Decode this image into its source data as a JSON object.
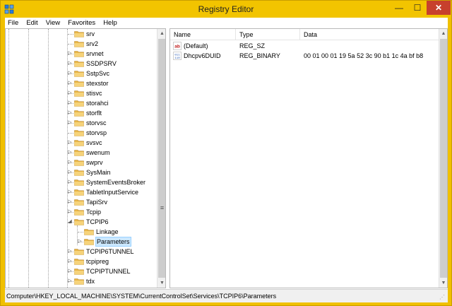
{
  "window": {
    "title": "Registry Editor",
    "minimize_glyph": "—",
    "maximize_glyph": "☐",
    "close_glyph": "✕",
    "accent": "#f2c400",
    "close_color": "#c7402d"
  },
  "menu": {
    "items": [
      "File",
      "Edit",
      "View",
      "Favorites",
      "Help"
    ]
  },
  "tree": {
    "expand_glyph": "▷",
    "collapse_glyph": "◢",
    "items": [
      {
        "label": "srv",
        "expander": "none",
        "indent": 0
      },
      {
        "label": "srv2",
        "expander": "none",
        "indent": 0
      },
      {
        "label": "srvnet",
        "expander": "collapsed",
        "indent": 0
      },
      {
        "label": "SSDPSRV",
        "expander": "collapsed",
        "indent": 0
      },
      {
        "label": "SstpSvc",
        "expander": "collapsed",
        "indent": 0
      },
      {
        "label": "stexstor",
        "expander": "collapsed",
        "indent": 0
      },
      {
        "label": "stisvc",
        "expander": "collapsed",
        "indent": 0
      },
      {
        "label": "storahci",
        "expander": "collapsed",
        "indent": 0
      },
      {
        "label": "storflt",
        "expander": "collapsed",
        "indent": 0
      },
      {
        "label": "storvsc",
        "expander": "collapsed",
        "indent": 0
      },
      {
        "label": "storvsp",
        "expander": "none",
        "indent": 0
      },
      {
        "label": "svsvc",
        "expander": "collapsed",
        "indent": 0
      },
      {
        "label": "swenum",
        "expander": "collapsed",
        "indent": 0
      },
      {
        "label": "swprv",
        "expander": "collapsed",
        "indent": 0
      },
      {
        "label": "SysMain",
        "expander": "collapsed",
        "indent": 0
      },
      {
        "label": "SystemEventsBroker",
        "expander": "collapsed",
        "indent": 0
      },
      {
        "label": "TabletInputService",
        "expander": "collapsed",
        "indent": 0
      },
      {
        "label": "TapiSrv",
        "expander": "collapsed",
        "indent": 0
      },
      {
        "label": "Tcpip",
        "expander": "collapsed",
        "indent": 0
      },
      {
        "label": "TCPIP6",
        "expander": "expanded",
        "indent": 0
      },
      {
        "label": "Linkage",
        "expander": "none",
        "indent": 1
      },
      {
        "label": "Parameters",
        "expander": "collapsed",
        "indent": 1,
        "selected": true
      },
      {
        "label": "TCPIP6TUNNEL",
        "expander": "collapsed",
        "indent": 0
      },
      {
        "label": "tcpipreg",
        "expander": "collapsed",
        "indent": 0
      },
      {
        "label": "TCPIPTUNNEL",
        "expander": "collapsed",
        "indent": 0
      },
      {
        "label": "tdx",
        "expander": "collapsed",
        "indent": 0
      }
    ]
  },
  "list": {
    "columns": [
      "Name",
      "Type",
      "Data"
    ],
    "rows": [
      {
        "name": "(Default)",
        "type": "REG_SZ",
        "data": "",
        "icon": "string-value-icon",
        "icon_text": "ab"
      },
      {
        "name": "Dhcpv6DUID",
        "type": "REG_BINARY",
        "data": "00 01 00 01 19 5a 52 3c 90 b1 1c 4a bf b8",
        "icon": "binary-value-icon",
        "icon_text": "011 110"
      }
    ]
  },
  "scrollbar": {
    "up_glyph": "▲",
    "down_glyph": "▼",
    "grip_glyph": "≡"
  },
  "status": {
    "path": "Computer\\HKEY_LOCAL_MACHINE\\SYSTEM\\CurrentControlSet\\Services\\TCPIP6\\Parameters"
  }
}
